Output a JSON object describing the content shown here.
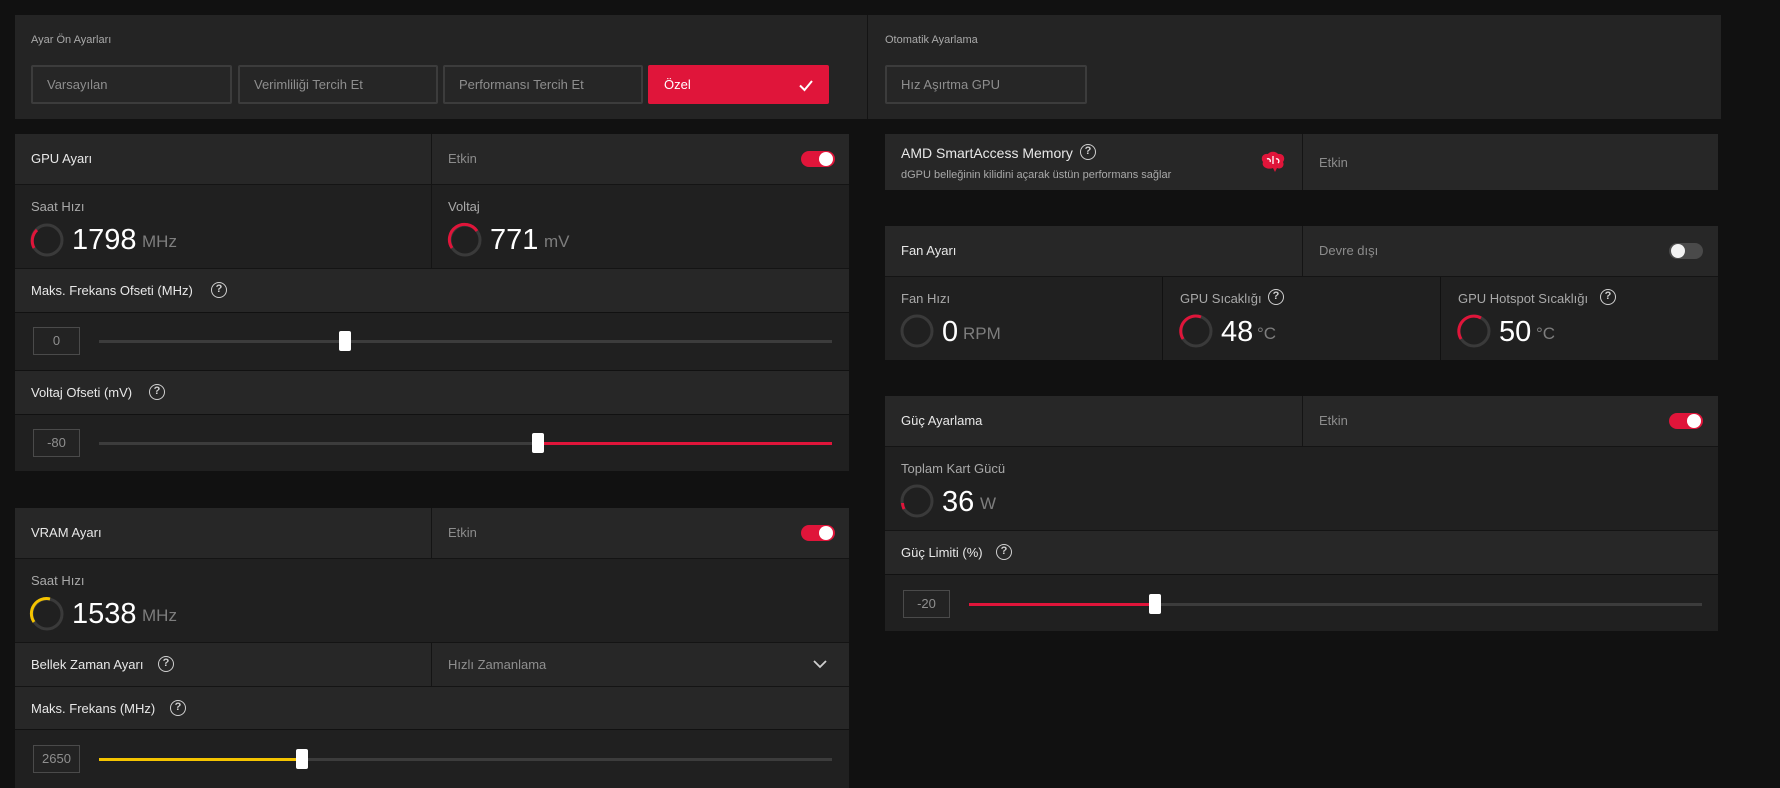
{
  "presets": {
    "label": "Ayar Ön Ayarları",
    "buttons": [
      "Varsayılan",
      "Verimliliği Tercih Et",
      "Performansı Tercih Et",
      "Özel"
    ],
    "selected": "Özel"
  },
  "auto_tuning": {
    "label": "Otomatik Ayarlama",
    "button": "Hız Aşırtma GPU"
  },
  "gpu_tuning": {
    "title": "GPU Ayarı",
    "status": "Etkin",
    "enabled": true,
    "clock_label": "Saat Hızı",
    "clock_value": "1798",
    "clock_unit": "MHz",
    "voltage_label": "Voltaj",
    "voltage_value": "771",
    "voltage_unit": "mV",
    "max_freq_offset_label": "Maks. Frekans Ofseti (MHz)",
    "max_freq_offset_value": "0",
    "max_freq_offset_fraction": 0.33,
    "voltage_offset_label": "Voltaj Ofseti (mV)",
    "voltage_offset_value": "-80",
    "voltage_offset_fraction": 0.6
  },
  "vram_tuning": {
    "title": "VRAM Ayarı",
    "status": "Etkin",
    "enabled": true,
    "clock_label": "Saat Hızı",
    "clock_value": "1538",
    "clock_unit": "MHz",
    "memory_timing_label": "Bellek Zaman Ayarı",
    "memory_timing_value": "Hızlı Zamanlama",
    "max_freq_label": "Maks. Frekans (MHz)",
    "max_freq_value": "2650",
    "max_freq_fraction": 0.28
  },
  "smart_access": {
    "title": "AMD SmartAccess Memory",
    "description": "dGPU belleğinin kilidini açarak üstün performans sağlar",
    "status": "Etkin"
  },
  "fan_tuning": {
    "title": "Fan Ayarı",
    "status": "Devre dışı",
    "enabled": false,
    "fan_speed_label": "Fan Hızı",
    "fan_speed_value": "0",
    "fan_speed_unit": "RPM",
    "gpu_temp_label": "GPU Sıcaklığı",
    "gpu_temp_value": "48",
    "gpu_temp_unit": "°C",
    "hotspot_temp_label": "GPU Hotspot Sıcaklığı",
    "hotspot_temp_value": "50",
    "hotspot_temp_unit": "°C"
  },
  "power_tuning": {
    "title": "Güç Ayarlama",
    "status": "Etkin",
    "enabled": true,
    "total_power_label": "Toplam Kart Gücü",
    "total_power_value": "36",
    "total_power_unit": "W",
    "power_limit_label": "Güç Limiti (%)",
    "power_limit_value": "-20",
    "power_limit_fraction": 0.25
  },
  "colors": {
    "accent_red": "#e0153a",
    "accent_yellow": "#f5c400",
    "panel": "#242424",
    "background": "#111111"
  },
  "icons": [
    "check-icon",
    "help-icon",
    "brain-icon",
    "chevron-down-icon",
    "gauge-icon"
  ]
}
